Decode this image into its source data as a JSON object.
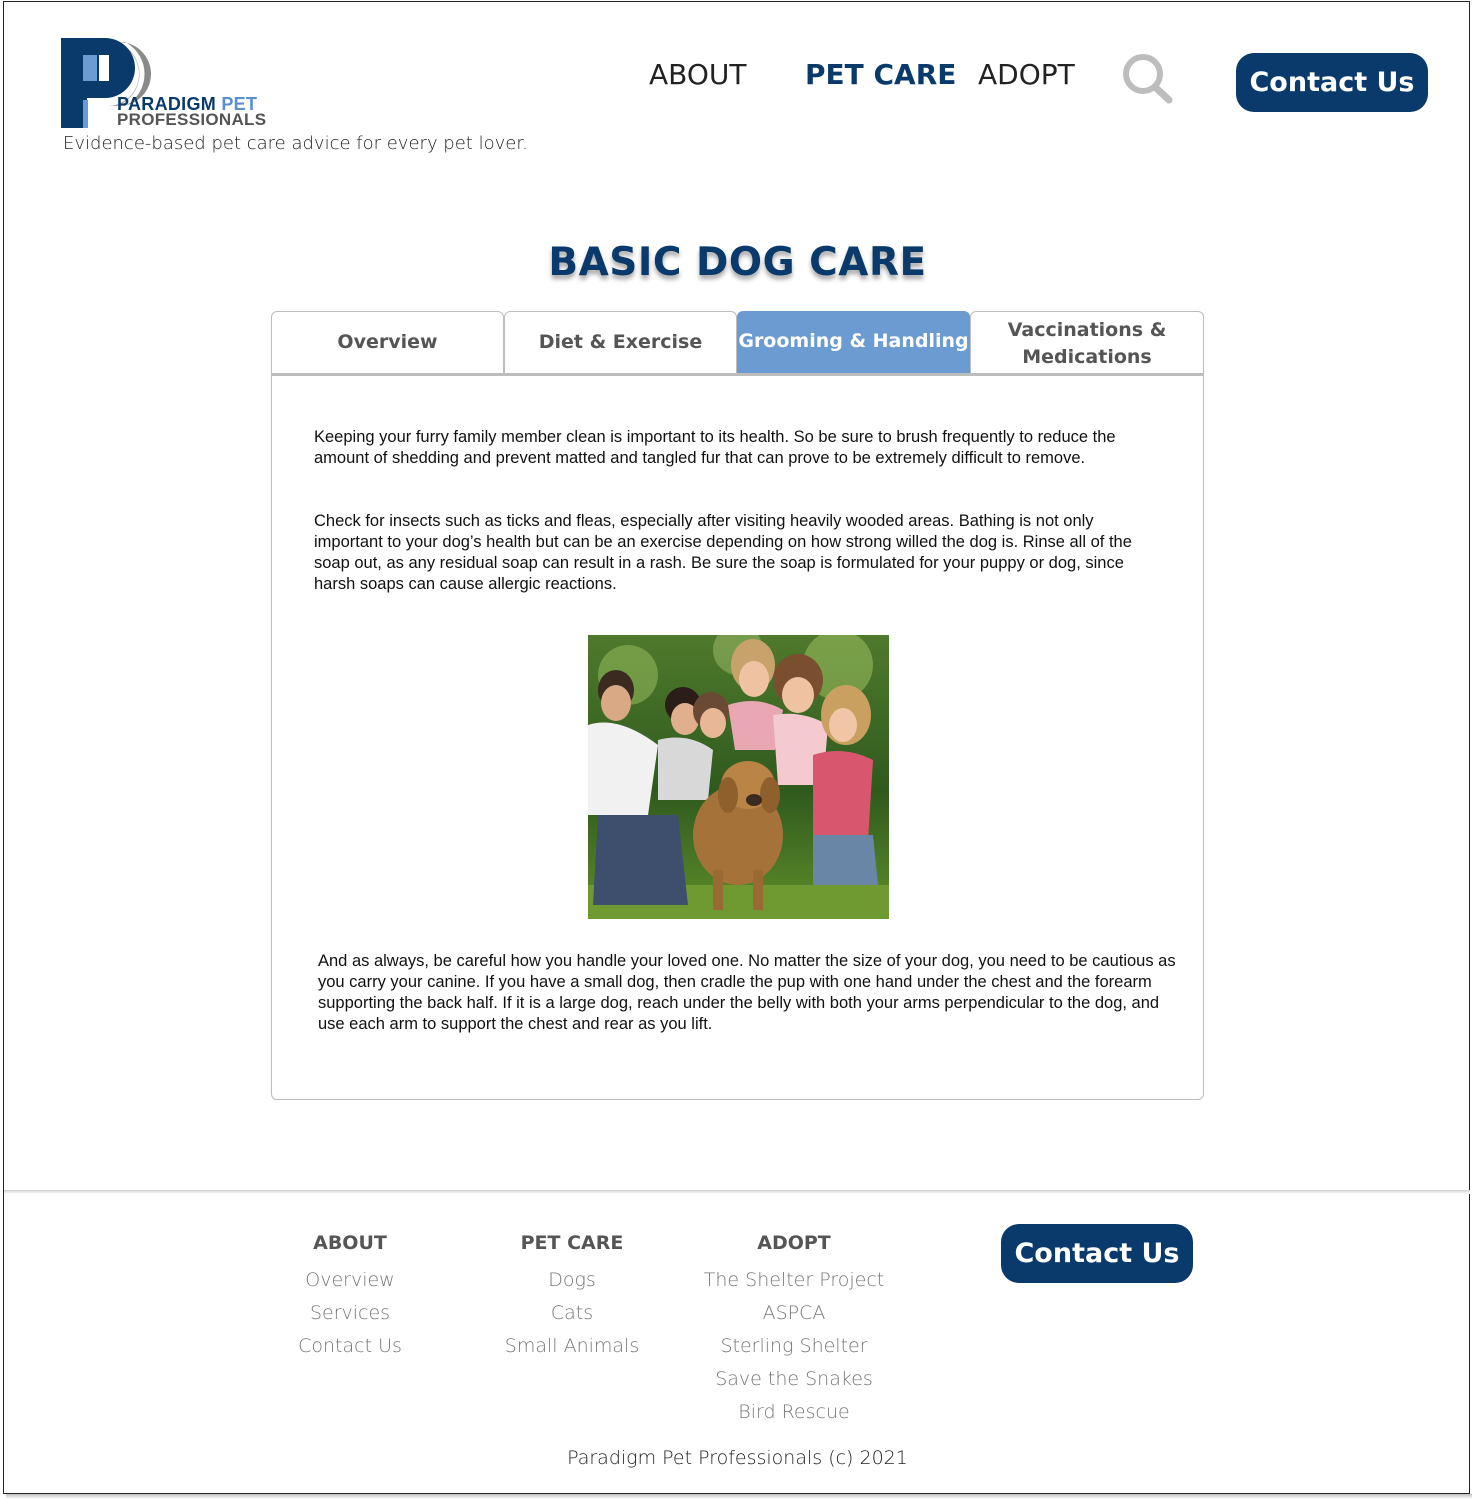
{
  "brand": {
    "name_line1": "PARADIGM",
    "name_line1_accent": "PET",
    "name_line2": "PROFESSIONALS",
    "tagline": "Evidence-based pet care advice for every pet lover.",
    "colors": {
      "navy": "#0a3a6b",
      "light_blue": "#6b9bd1",
      "grey": "#777777"
    }
  },
  "nav": {
    "items": [
      {
        "label": "ABOUT",
        "active": false
      },
      {
        "label": "PET CARE",
        "active": true
      },
      {
        "label": "ADOPT",
        "active": false
      }
    ],
    "search_icon": "search-icon",
    "contact_label": "Contact Us"
  },
  "main": {
    "title": "BASIC DOG CARE",
    "tabs": [
      {
        "label": "Overview",
        "active": false
      },
      {
        "label": "Diet & Exercise",
        "active": false
      },
      {
        "label": "Grooming & Handling",
        "active": true
      },
      {
        "label": "Vaccinations & Medications",
        "active": false
      }
    ],
    "paragraphs": [
      "Keeping your furry family member clean is important to its health. So be sure to brush frequently to reduce the amount of shedding and prevent matted and tangled fur that can prove to be extremely difficult to remove.",
      "Check for insects such as ticks and fleas, especially after visiting heavily wooded areas. Bathing is not only important to your dog’s health but can be an exercise depending on how strong willed the dog is. Rinse all of the soap out, as any residual soap can result in a rash. Be sure the soap is formulated for your puppy or dog, since harsh soaps can cause allergic reactions.",
      "And as always, be careful how you handle your loved one. No matter the size of your dog, you need to be cautious as you carry your canine. If you have a small dog, then cradle the pup with one hand under the chest and the forearm supporting the back half. If it is a large dog, reach under the belly with both your arms perpendicular to the dog, and use each arm to support the chest and rear as you lift."
    ]
  },
  "footer": {
    "columns": [
      {
        "heading": "ABOUT",
        "links": [
          "Overview",
          "Services",
          "Contact Us"
        ]
      },
      {
        "heading": "PET CARE",
        "links": [
          "Dogs",
          "Cats",
          "Small Animals"
        ]
      },
      {
        "heading": "ADOPT",
        "links": [
          "The Shelter Project",
          "ASPCA",
          "Sterling Shelter",
          "Save the Snakes",
          "Bird Rescue"
        ]
      }
    ],
    "contact_label": "Contact Us",
    "copyright": "Paradigm Pet Professionals (c) 2021"
  }
}
